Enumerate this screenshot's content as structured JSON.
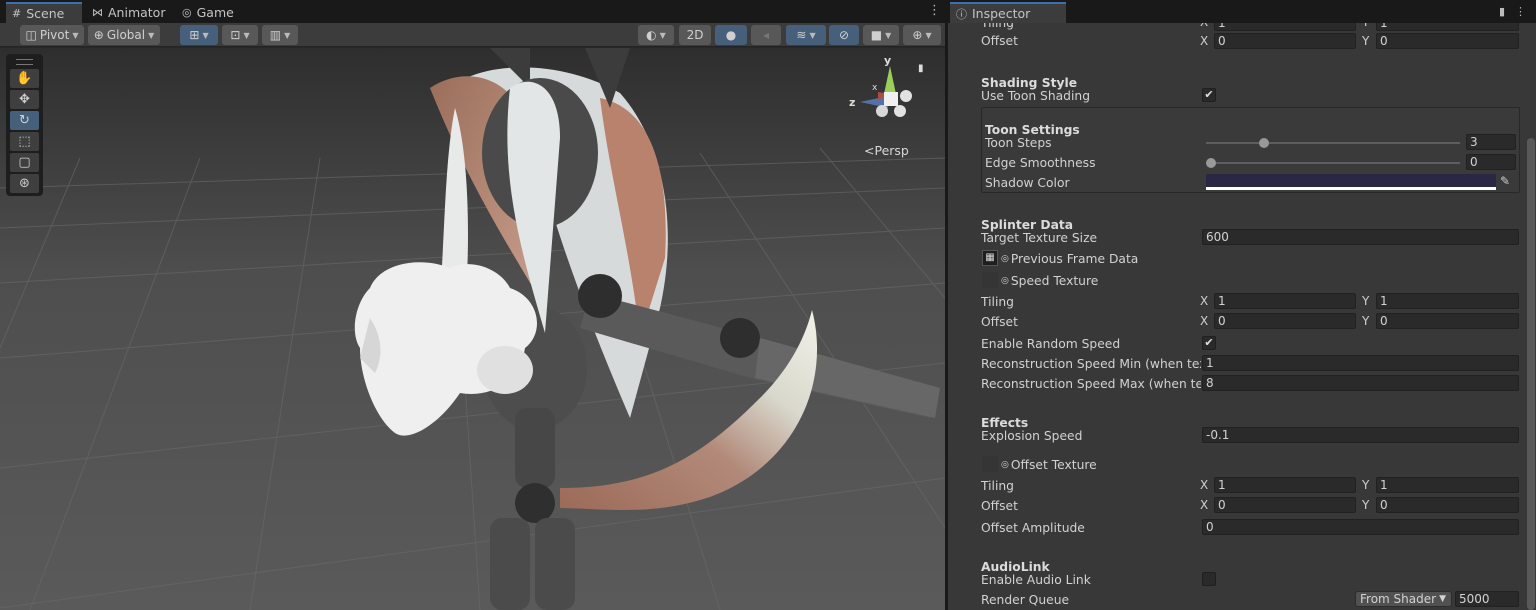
{
  "scene": {
    "tabs": [
      {
        "icon": "grid-icon",
        "label": "Scene"
      },
      {
        "icon": "animator-icon",
        "label": "Animator"
      },
      {
        "icon": "gamepad-icon",
        "label": "Game"
      }
    ],
    "toolbar": {
      "pivot_label": "Pivot",
      "global_label": "Global",
      "mode_2d_label": "2D"
    },
    "tools": [
      "hand-tool",
      "move-tool",
      "rotate-tool",
      "scale-tool",
      "rect-tool",
      "transform-tool"
    ],
    "gizmo": {
      "axis_y": "y",
      "axis_z": "z",
      "axis_x": "x"
    },
    "projection_label": "Persp"
  },
  "inspector": {
    "tab_label": "Inspector",
    "rows": {
      "top_tiling": {
        "label": "Tiling",
        "x": "1",
        "y": "1"
      },
      "top_offset": {
        "label": "Offset",
        "x": "0",
        "y": "0"
      },
      "shading_header": "Shading Style",
      "use_toon": {
        "label": "Use Toon Shading",
        "checked": true
      },
      "toon_header": "Toon Settings",
      "toon_steps": {
        "label": "Toon Steps",
        "value": "3",
        "slider_fraction": 0.23
      },
      "edge_smooth": {
        "label": "Edge Smoothness",
        "value": "0",
        "slider_fraction": 0.0
      },
      "shadow_color": {
        "label": "Shadow Color",
        "color": "#2a2745"
      },
      "splinter_header": "Splinter Data",
      "target_tex": {
        "label": "Target Texture Size",
        "value": "600"
      },
      "prev_frame": {
        "label": "Previous Frame Data"
      },
      "speed_tex": {
        "label": "Speed Texture"
      },
      "tiling2": {
        "label": "Tiling",
        "x": "1",
        "y": "1"
      },
      "offset2": {
        "label": "Offset",
        "x": "0",
        "y": "0"
      },
      "random_speed": {
        "label": "Enable Random Speed",
        "checked": true
      },
      "recon_min": {
        "label": "Reconstruction Speed Min (when textu",
        "value": "1"
      },
      "recon_max": {
        "label": "Reconstruction Speed Max (when textu",
        "value": "8"
      },
      "effects_header": "Effects",
      "explosion": {
        "label": "Explosion Speed",
        "value": "-0.1"
      },
      "offset_tex": {
        "label": "Offset Texture"
      },
      "tiling3": {
        "label": "Tiling",
        "x": "1",
        "y": "1"
      },
      "offset3": {
        "label": "Offset",
        "x": "0",
        "y": "0"
      },
      "offset_amp": {
        "label": "Offset Amplitude",
        "value": "0"
      },
      "audiolink_header": "AudioLink",
      "audio_link": {
        "label": "Enable Audio Link",
        "checked": false
      },
      "render_queue": {
        "label": "Render Queue",
        "mode": "From Shader",
        "value": "5000"
      }
    },
    "axis_x": "X",
    "axis_y": "Y"
  }
}
